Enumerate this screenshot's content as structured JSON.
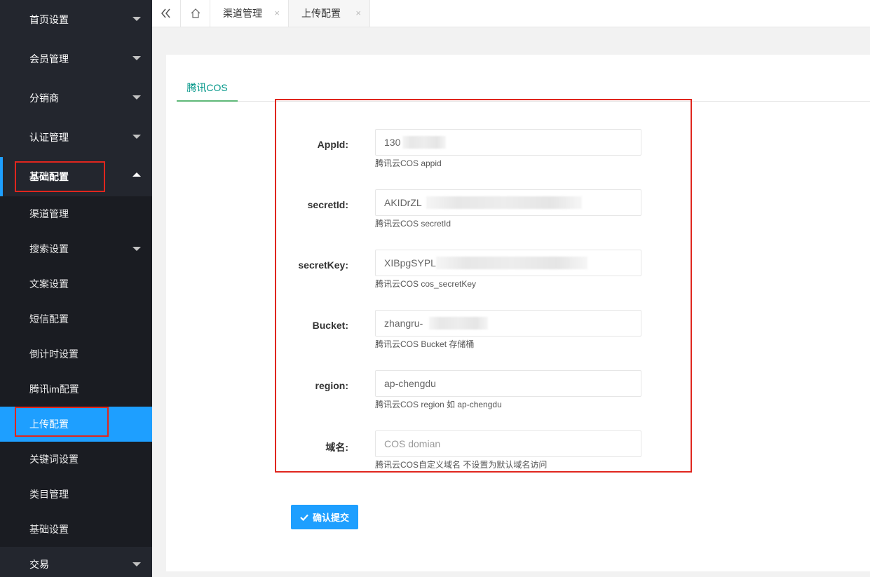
{
  "sidebar": {
    "top_items": [
      {
        "label": "首页设置"
      },
      {
        "label": "会员管理"
      },
      {
        "label": "分销商"
      },
      {
        "label": "认证管理"
      }
    ],
    "open_item": {
      "label": "基础配置"
    },
    "sub_items": [
      {
        "label": "渠道管理"
      },
      {
        "label": "搜索设置"
      },
      {
        "label": "文案设置"
      },
      {
        "label": "短信配置"
      },
      {
        "label": "倒计时设置"
      },
      {
        "label": "腾讯im配置"
      },
      {
        "label": "上传配置"
      },
      {
        "label": "关键词设置"
      },
      {
        "label": "类目管理"
      },
      {
        "label": "基础设置"
      }
    ],
    "bottom_item": {
      "label": "交易"
    }
  },
  "tabs": {
    "items": [
      {
        "label": "渠道管理",
        "close": "×"
      },
      {
        "label": "上传配置",
        "close": "×"
      }
    ]
  },
  "subtab": {
    "label": "腾讯COS"
  },
  "form": {
    "fields": [
      {
        "label": "AppId:",
        "value": "130",
        "help": "腾讯云COS appid"
      },
      {
        "label": "secretId:",
        "value": "AKIDrZL",
        "help": "腾讯云COS secretId"
      },
      {
        "label": "secretKey:",
        "value": "XIBpgSYPL",
        "help": "腾讯云COS cos_secretKey"
      },
      {
        "label": "Bucket:",
        "value": "zhangru-",
        "help": "腾讯云COS Bucket 存储桶"
      },
      {
        "label": "region:",
        "value": "ap-chengdu",
        "help": "腾讯云COS region 如 ap-chengdu"
      },
      {
        "label": "域名:",
        "value": "",
        "placeholder": "COS domian",
        "help": "腾讯云COS自定义域名 不设置为默认域名访问"
      }
    ],
    "submit_label": "确认提交"
  },
  "colors": {
    "sidebar_bg": "#23262e",
    "accent": "#1e9fff",
    "tab_green": "#009688",
    "highlight_red": "#e0261e"
  }
}
